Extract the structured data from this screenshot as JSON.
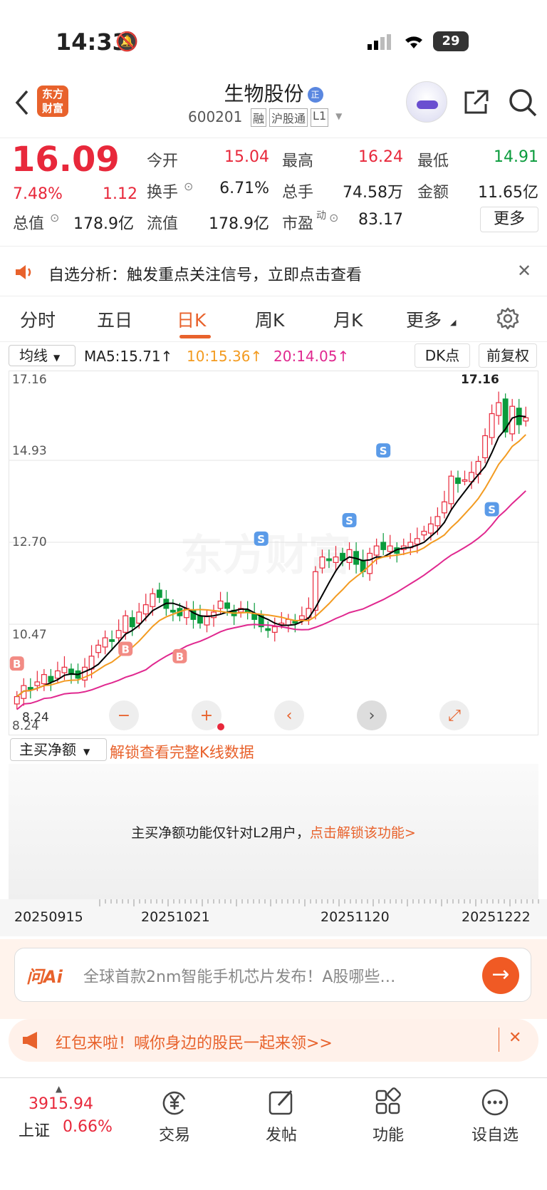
{
  "status_bar": {
    "time": "14:33",
    "battery": "29"
  },
  "header": {
    "brand_line1": "东方",
    "brand_line2": "财富",
    "title": "生物股份",
    "code": "600201",
    "badges": [
      "融",
      "沪股通",
      "L1"
    ],
    "title_badge": "正"
  },
  "quote": {
    "price": "16.09",
    "change_pct": "7.48%",
    "change": "1.12",
    "open_label": "今开",
    "open": "15.04",
    "high_label": "最高",
    "high": "16.24",
    "low_label": "最低",
    "low": "14.91",
    "turnover_label": "换手",
    "turnover": "6.71%",
    "volume_label": "总手",
    "volume": "74.58万",
    "amount_label": "金额",
    "amount": "11.65亿",
    "mktcap_label": "总值",
    "mktcap": "178.9亿",
    "float_label": "流值",
    "float": "178.9亿",
    "pe_label": "市盈",
    "pe_sup": "动",
    "pe": "83.17",
    "more_label": "更多"
  },
  "notice": {
    "text": "自选分析：触发重点关注信号，立即点击查看"
  },
  "tabs": [
    "分时",
    "五日",
    "日K",
    "周K",
    "月K",
    "更多"
  ],
  "active_tab": "日K",
  "ma_bar": {
    "selector": "均线",
    "ma5": "MA5:15.71↑",
    "ma10": "10:15.36↑",
    "ma20": "20:14.05↑",
    "dk": "DK点",
    "fq": "前复权"
  },
  "colors": {
    "up": "#e8283b",
    "down": "#0a9b3c",
    "ma5": "#000000",
    "ma10": "#f39b21",
    "ma20": "#e0288f",
    "accent": "#e8622c"
  },
  "chart_data": {
    "type": "candlestick",
    "y_ticks": [
      "17.16",
      "14.93",
      "12.70",
      "10.47"
    ],
    "y_range": [
      8.24,
      17.16
    ],
    "max_label": "17.16",
    "min_label": "8.24",
    "left_label": "8.24",
    "markers": [
      "B",
      "B",
      "B",
      "S",
      "S",
      "S",
      "S"
    ],
    "date_ticks": [
      "20250915",
      "20251021",
      "20251120",
      "20251222"
    ],
    "closes": [
      8.5,
      8.8,
      8.7,
      8.9,
      9.1,
      8.9,
      9.2,
      9.3,
      9.1,
      9.0,
      9.3,
      9.6,
      9.9,
      10.1,
      10.0,
      10.3,
      10.7,
      10.4,
      10.8,
      11.0,
      11.3,
      11.2,
      10.9,
      10.8,
      10.7,
      10.9,
      10.6,
      10.5,
      10.7,
      10.8,
      11.1,
      10.9,
      10.7,
      10.9,
      10.8,
      10.6,
      10.4,
      10.3,
      10.4,
      10.5,
      10.6,
      10.5,
      10.7,
      10.9,
      11.9,
      12.3,
      12.2,
      12.3,
      12.2,
      12.5,
      12.1,
      11.9,
      12.4,
      12.6,
      12.5,
      12.6,
      12.4,
      12.6,
      12.7,
      12.8,
      13.0,
      13.2,
      13.4,
      13.8,
      14.5,
      14.3,
      14.4,
      14.6,
      14.9,
      15.6,
      16.2,
      16.5,
      15.7,
      16.4,
      15.9,
      16.09
    ],
    "ma5": 15.71,
    "ma10": 15.36,
    "ma20": 14.05
  },
  "buttons": {
    "zoom_out": "−",
    "zoom_in": "+",
    "prev": "‹",
    "next": "›",
    "expand": "⤢"
  },
  "indicator": {
    "selector": "主买净额",
    "unlock": "解锁查看完整K线数据",
    "panel_text": "主买净额功能仅针对L2用户，",
    "panel_link": "点击解锁该功能>"
  },
  "ai": {
    "logo": "问Ai",
    "placeholder": "全球首款2nm智能手机芯片发布！A股哪些…"
  },
  "redpack": {
    "text": "红包来啦！喊你身边的股民一起来领>>"
  },
  "nav": {
    "index_value": "3915.94",
    "index_name": "上证",
    "index_change": "0.66%",
    "items": [
      "交易",
      "发帖",
      "功能",
      "设自选"
    ]
  }
}
